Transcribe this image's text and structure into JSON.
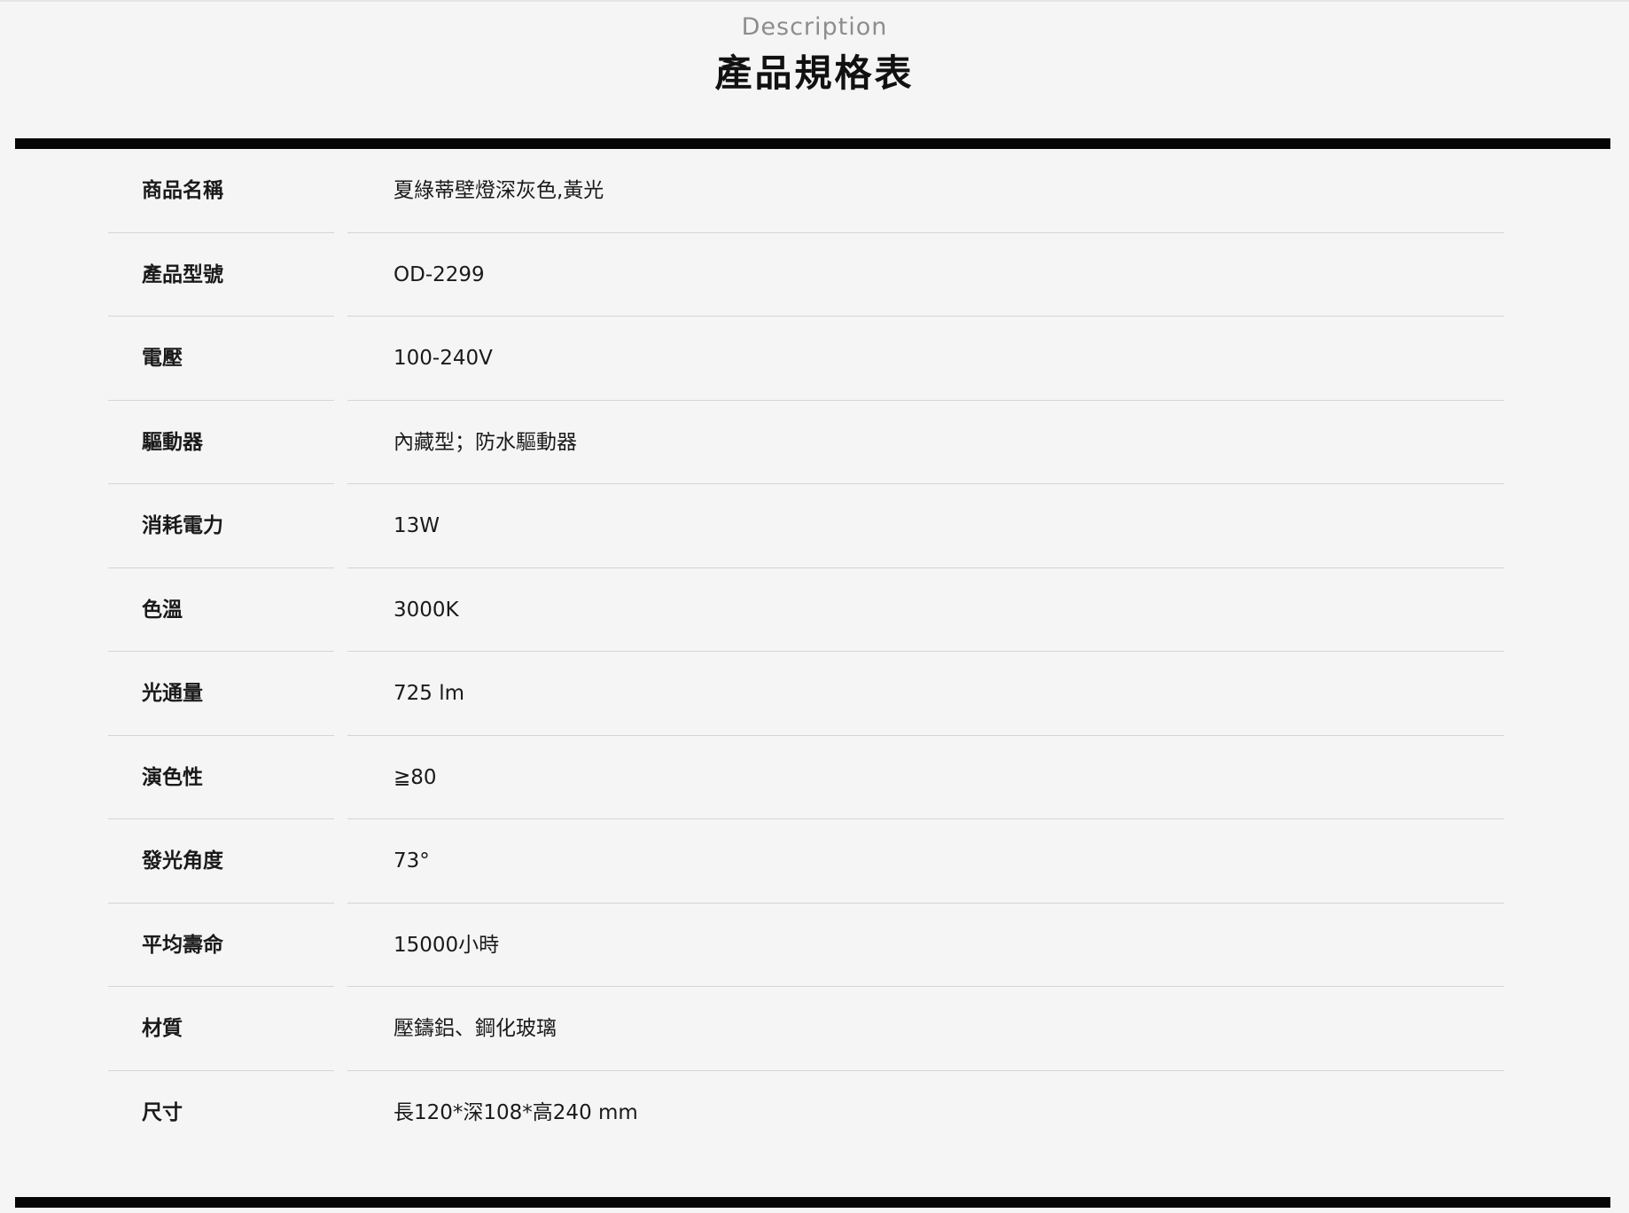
{
  "header": {
    "subtitle": "Description",
    "title": "產品規格表"
  },
  "specs": [
    {
      "label": "商品名稱",
      "value": "夏綠蒂壁燈深灰色,黃光"
    },
    {
      "label": "產品型號",
      "value": "OD-2299"
    },
    {
      "label": "電壓",
      "value": "100-240V"
    },
    {
      "label": "驅動器",
      "value": "內藏型；防水驅動器"
    },
    {
      "label": "消耗電力",
      "value": "13W"
    },
    {
      "label": "色溫",
      "value": "3000K"
    },
    {
      "label": "光通量",
      "value": "725 lm"
    },
    {
      "label": "演色性",
      "value": "≧80"
    },
    {
      "label": "發光角度",
      "value": "73°"
    },
    {
      "label": "平均壽命",
      "value": "15000小時"
    },
    {
      "label": "材質",
      "value": "壓鑄鋁、鋼化玻璃"
    },
    {
      "label": "尺寸",
      "value": "長120*深108*高240 mm"
    }
  ]
}
